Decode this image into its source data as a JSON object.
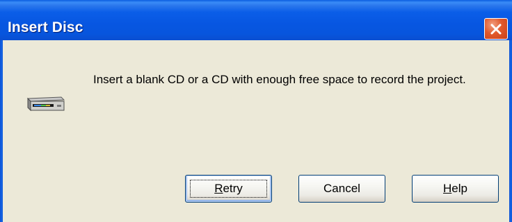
{
  "dialog": {
    "title": "Insert Disc",
    "message": "Insert a blank CD or a CD with enough free space to record the project.",
    "icon": "cd-drive-icon",
    "close_icon": "close-icon"
  },
  "buttons": {
    "retry": {
      "accel": "R",
      "rest": "etry",
      "default": true
    },
    "cancel": {
      "label": "Cancel"
    },
    "help": {
      "accel": "H",
      "rest": "elp"
    }
  },
  "colors": {
    "titlebar": "#0756e1",
    "close_button": "#e1592c",
    "dialog_background": "#ece9d8",
    "button_border": "#003c74"
  }
}
